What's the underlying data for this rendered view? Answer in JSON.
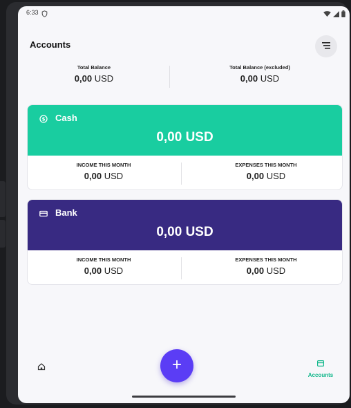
{
  "status_bar": {
    "time": "6:33"
  },
  "header": {
    "title": "Accounts",
    "menu_icon": "sort-icon"
  },
  "totals": {
    "total_balance_label": "Total Balance",
    "total_balance_amount": "0,00",
    "total_balance_currency": "USD",
    "excluded_label": "Total Balance (excluded)",
    "excluded_amount": "0,00",
    "excluded_currency": "USD"
  },
  "accounts": [
    {
      "name": "Cash",
      "icon": "dollar-circle-icon",
      "color": "#19cda0",
      "balance": "0,00 USD",
      "income_label": "INCOME THIS MONTH",
      "income_amount": "0,00",
      "income_currency": "USD",
      "expenses_label": "EXPENSES THIS MONTH",
      "expenses_amount": "0,00",
      "expenses_currency": "USD"
    },
    {
      "name": "Bank",
      "icon": "credit-card-icon",
      "color": "#382a82",
      "balance": "0,00 USD",
      "income_label": "INCOME THIS MONTH",
      "income_amount": "0,00",
      "income_currency": "USD",
      "expenses_label": "EXPENSES THIS MONTH",
      "expenses_amount": "0,00",
      "expenses_currency": "USD"
    }
  ],
  "fab": {
    "label": "+"
  },
  "bottom_nav": {
    "home_icon": "home-icon",
    "accounts_label": "Accounts",
    "accounts_icon": "wallet-icon",
    "active_color": "#14b88c"
  }
}
